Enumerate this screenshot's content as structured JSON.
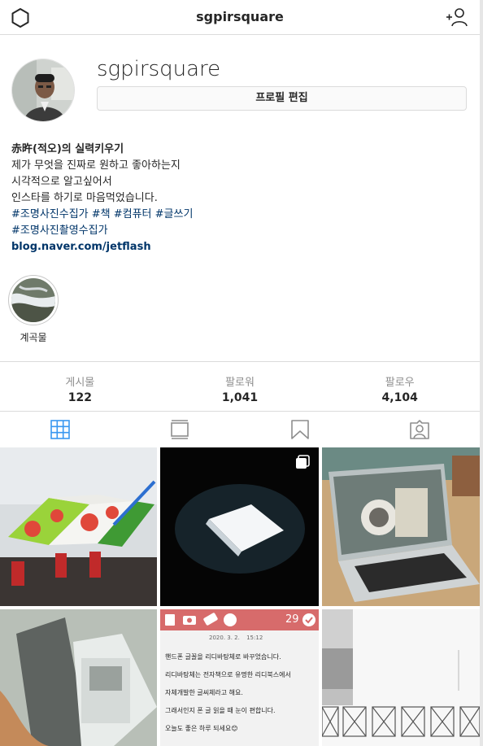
{
  "header": {
    "title": "sgpirsquare"
  },
  "profile": {
    "username": "sgpirsquare",
    "edit_label": "프로필 편집"
  },
  "bio": {
    "name": "赤旿(적오)의 실력키우기",
    "lines": [
      "제가 무엇을 진짜로 원하고 좋아하는지",
      "시각적으로 알고싶어서",
      "인스타를 하기로 마음먹었습니다."
    ],
    "hashtags_1": "#조명사진수집가 #책 #컴퓨터 #글쓰기",
    "hashtags_2": "#조명사진촬영수집가",
    "link": "blog.naver.com/jetflash"
  },
  "highlights": [
    {
      "label": "계곡물"
    }
  ],
  "stats": [
    {
      "label": "게시물",
      "value": "122"
    },
    {
      "label": "팔로워",
      "value": "1,041"
    },
    {
      "label": "팔로우",
      "value": "4,104"
    }
  ],
  "note_post": {
    "count": "29",
    "date": "2020. 3. 2.",
    "time": "15:12",
    "lines": [
      "핸드폰 글꼴을 리디바탕체로 바꾸었습니다.",
      "리디바탕체는 전자책으로 유명한 리디북스에서",
      "자체개발한 글씨체라고 해요.",
      "그래서인지 폰 글 읽을 때 눈이 편합니다.",
      "오늘도 좋은 하루 되세요😊"
    ]
  },
  "colors": {
    "link": "#003569",
    "accent_tab": "#3897f0",
    "note_header": "#d76b6b"
  }
}
